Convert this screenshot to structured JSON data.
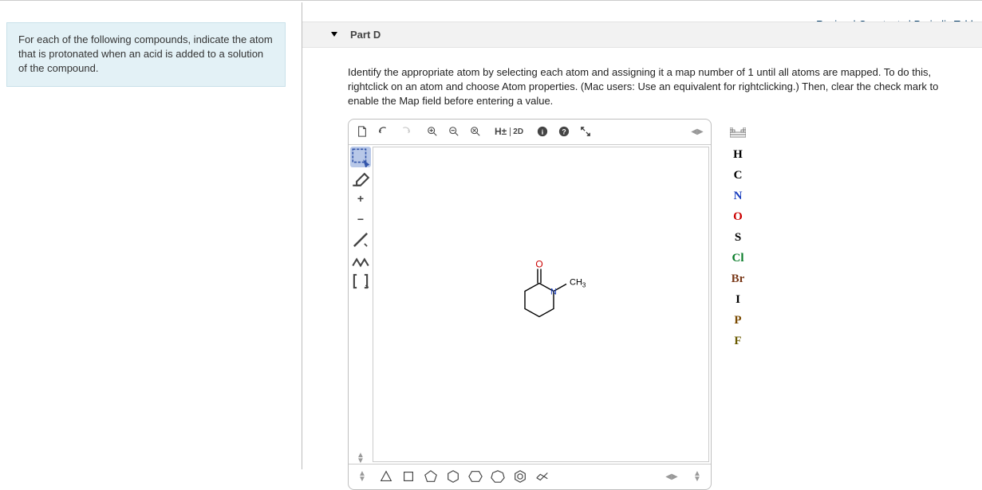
{
  "prompt": "For each of the following compounds, indicate the atom that is protonated when an acid is added to a solution of the compound.",
  "header": {
    "review": "Review",
    "constants": "Constants",
    "periodic": "Periodic Table"
  },
  "part": {
    "label": "Part D",
    "instruction": "Identify the appropriate atom by selecting each atom and assigning it a map number of 1 until all atoms are mapped. To do this, rightclick on an atom and choose Atom properties. (Mac users: Use an equivalent for rightclicking.) Then, clear the check mark to enable the Map field before entering a value."
  },
  "toolbar": {
    "hplus": "H±",
    "twod": "2D"
  },
  "leftTools": {
    "plus": "+",
    "minus": "−"
  },
  "molecule": {
    "oxygen": "O",
    "nitrogen": "N",
    "methyl": "CH",
    "methylSub": "3"
  },
  "elements": [
    {
      "label": "H",
      "color": "#000"
    },
    {
      "label": "C",
      "color": "#000"
    },
    {
      "label": "N",
      "color": "#1a3fbf"
    },
    {
      "label": "O",
      "color": "#c00"
    },
    {
      "label": "S",
      "color": "#000"
    },
    {
      "label": "Cl",
      "color": "#0a7d2a"
    },
    {
      "label": "Br",
      "color": "#7a3a1a"
    },
    {
      "label": "I",
      "color": "#000"
    },
    {
      "label": "P",
      "color": "#7a4a00"
    },
    {
      "label": "F",
      "color": "#6a5a00"
    }
  ]
}
